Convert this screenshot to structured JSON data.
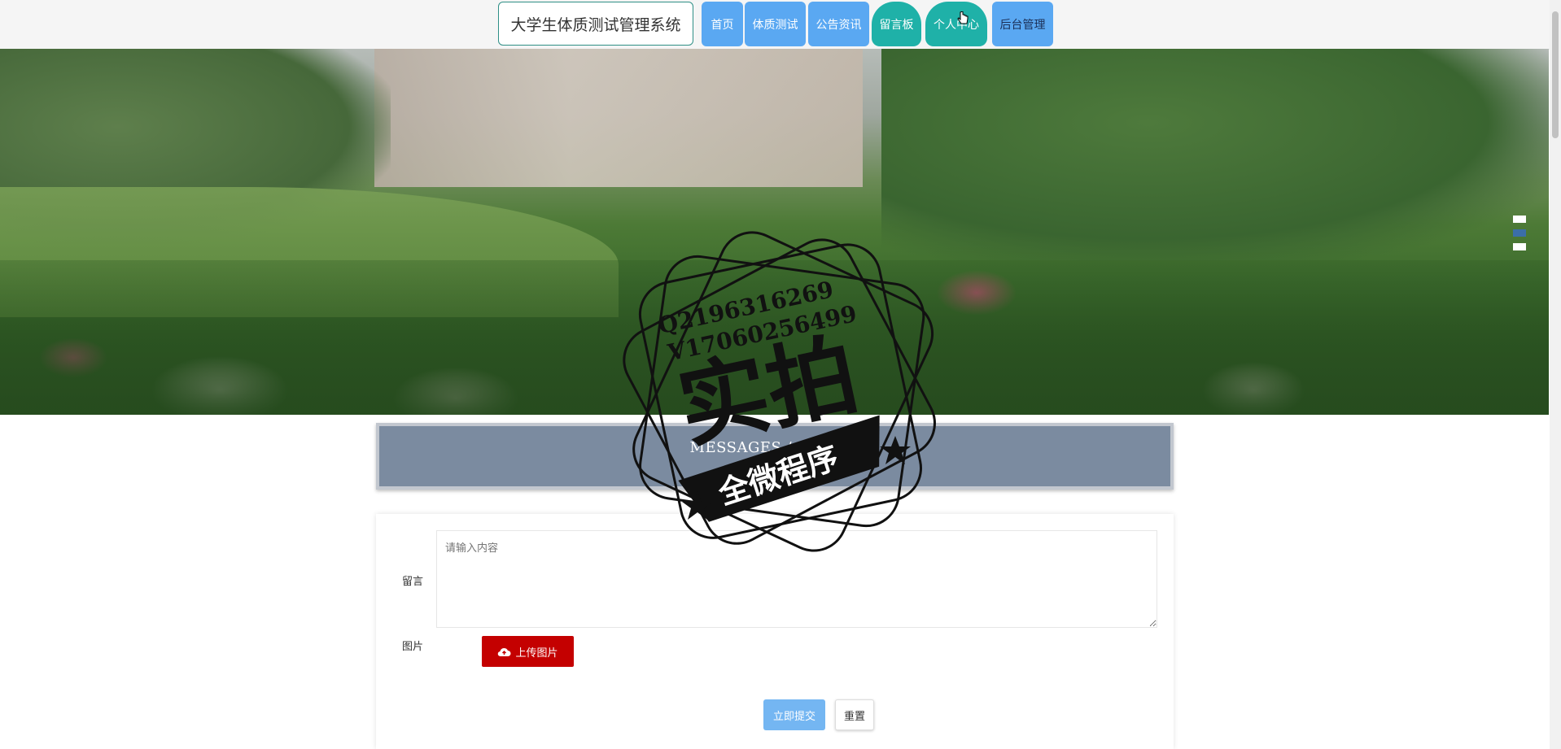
{
  "header": {
    "site_title": "大学生体质测试管理系统",
    "nav": [
      {
        "label": "首页"
      },
      {
        "label": "体质测试"
      },
      {
        "label": "公告资讯"
      },
      {
        "label": "留言板"
      },
      {
        "label": "个人中心"
      },
      {
        "label": "后台管理"
      }
    ]
  },
  "banner": {
    "slides": 3,
    "active_slide": 2
  },
  "section": {
    "title_en": "MESSAGES / ADVICE",
    "title_cn": "留言板"
  },
  "form": {
    "message_label": "留言",
    "message_placeholder": "请输入内容",
    "image_label": "图片",
    "upload_label": "上传图片",
    "submit_label": "立即提交",
    "reset_label": "重置"
  },
  "watermark": {
    "line1": "Q2196316269",
    "line2": "V17060256499",
    "big_text": "实拍",
    "banner_text": "全微程序"
  },
  "colors": {
    "nav_blue": "#5aa8f2",
    "nav_teal": "#1fb1a8",
    "upload_red": "#c40000",
    "submit_blue": "#74b6f2",
    "section_bg": "#7b8ba0"
  }
}
